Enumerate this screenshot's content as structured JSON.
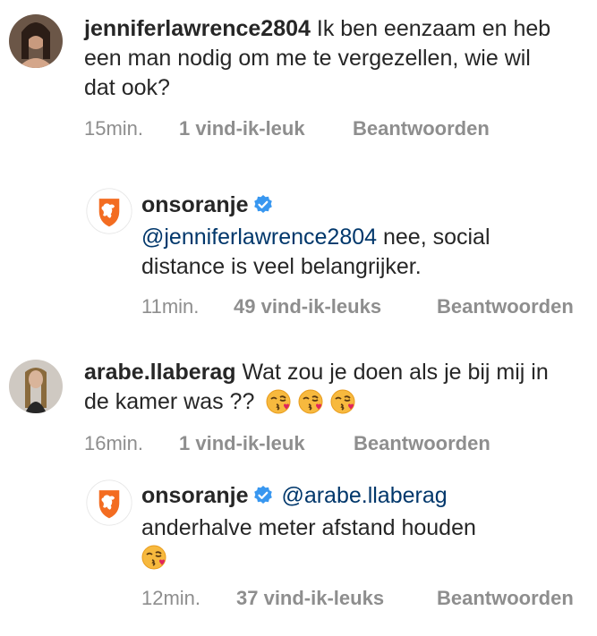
{
  "comments": [
    {
      "username": "jenniferlawrence2804",
      "text": " Ik ben eenzaam en heb een man nodig om me te vergezellen, wie wil dat ook?",
      "time": "15min.",
      "likes": "1 vind-ik-leuk",
      "reply": "Beantwoorden"
    },
    {
      "username": "onsoranje",
      "mention": "@jenniferlawrence2804",
      "text": " nee, social distance is veel belangrijker.",
      "time": "11min.",
      "likes": "49 vind-ik-leuks",
      "reply": "Beantwoorden"
    },
    {
      "username": "arabe.llaberag",
      "text": " Wat zou je doen als je bij mij in de kamer was ??",
      "time": "16min.",
      "likes": "1 vind-ik-leuk",
      "reply": "Beantwoorden"
    },
    {
      "username": "onsoranje",
      "mention": "@arabe.llaberag",
      "text": "anderhalve meter afstand houden",
      "time": "12min.",
      "likes": "37 vind-ik-leuks",
      "reply": "Beantwoorden"
    }
  ],
  "icons": {
    "verified": "verified-badge-icon",
    "emoji": "face-blowing-kiss-emoji"
  },
  "colors": {
    "verified": "#3897f0",
    "orange": "#f36c21",
    "mention": "#00376b",
    "meta": "#8e8e8e"
  }
}
